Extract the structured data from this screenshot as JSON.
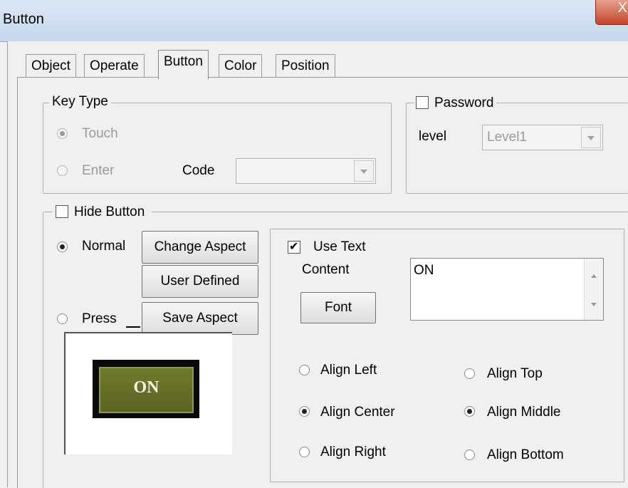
{
  "window": {
    "title": "Button",
    "close_glyph": "X"
  },
  "tabs": [
    {
      "label": "Object"
    },
    {
      "label": "Operate"
    },
    {
      "label": "Button",
      "active": true
    },
    {
      "label": "Color"
    },
    {
      "label": "Position"
    }
  ],
  "key_type": {
    "legend": "Key Type",
    "touch_label": "Touch",
    "touch_selected": true,
    "enter_label": "Enter",
    "enter_selected": false,
    "code_label": "Code",
    "code_value": ""
  },
  "password": {
    "label": "Password",
    "checked": false,
    "level_label": "level",
    "level_value": "Level1"
  },
  "hide_button": {
    "label": "Hide Button",
    "checked": false
  },
  "state": {
    "normal_label": "Normal",
    "normal_selected": true,
    "press_label": "Press",
    "press_selected": false
  },
  "aspect_buttons": {
    "change": "Change Aspect",
    "user_defined": "User Defined",
    "save": "Save Aspect"
  },
  "preview": {
    "button_text": "ON"
  },
  "use_text": {
    "label": "Use Text",
    "checked": true,
    "content_label": "Content",
    "content_value": "ON",
    "font_button": "Font"
  },
  "alignment": {
    "left": "Align Left",
    "center": "Align Center",
    "right": "Align Right",
    "top": "Align Top",
    "middle": "Align Middle",
    "bottom": "Align Bottom",
    "horizontal_selected": "Align Center",
    "vertical_selected": "Align Middle"
  },
  "colors": {
    "title_gradient": "#c5d7ee",
    "close_button": "#c2452c",
    "preview_button": "#6f7a2c"
  }
}
